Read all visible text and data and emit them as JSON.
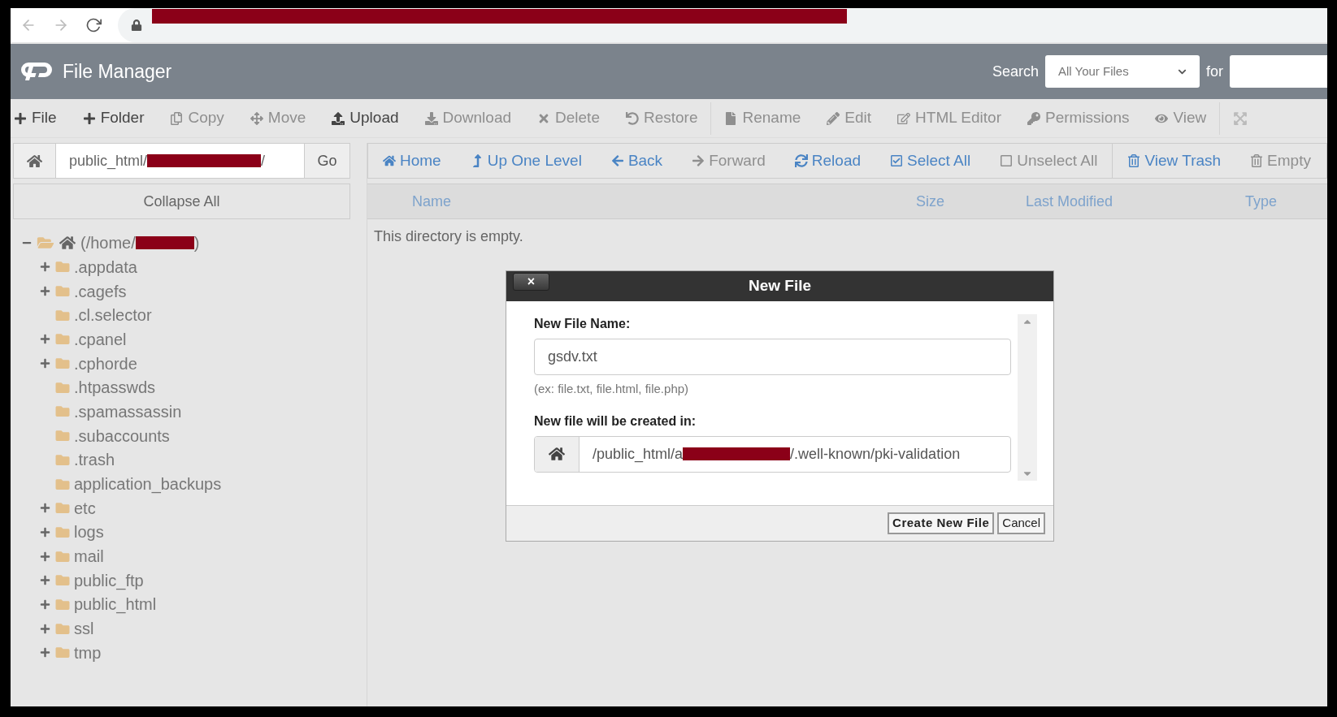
{
  "header": {
    "title": "File Manager",
    "search_label": "Search",
    "search_scope": "All Your Files",
    "for_label": "for"
  },
  "toolbar": [
    {
      "label": "File",
      "disabled": false
    },
    {
      "label": "Folder",
      "disabled": false
    },
    {
      "label": "Copy",
      "disabled": true
    },
    {
      "label": "Move",
      "disabled": true
    },
    {
      "label": "Upload",
      "disabled": false
    },
    {
      "label": "Download",
      "disabled": true
    },
    {
      "label": "Delete",
      "disabled": true
    },
    {
      "label": "Restore",
      "disabled": true
    },
    {
      "label": "Rename",
      "disabled": true
    },
    {
      "label": "Edit",
      "disabled": true
    },
    {
      "label": "HTML Editor",
      "disabled": true
    },
    {
      "label": "Permissions",
      "disabled": true
    },
    {
      "label": "View",
      "disabled": true
    }
  ],
  "path_bar": {
    "prefix": "public_html/",
    "suffix": "/",
    "go": "Go"
  },
  "collapse_all": "Collapse All",
  "tree": {
    "prefix": "(/home/",
    "suffix": ")",
    "expanded": true,
    "children": [
      {
        "label": ".appdata",
        "expandable": true
      },
      {
        "label": ".cagefs",
        "expandable": true
      },
      {
        "label": ".cl.selector",
        "expandable": false
      },
      {
        "label": ".cpanel",
        "expandable": true
      },
      {
        "label": ".cphorde",
        "expandable": true
      },
      {
        "label": ".htpasswds",
        "expandable": false
      },
      {
        "label": ".spamassassin",
        "expandable": false
      },
      {
        "label": ".subaccounts",
        "expandable": false
      },
      {
        "label": ".trash",
        "expandable": false
      },
      {
        "label": "application_backups",
        "expandable": false
      },
      {
        "label": "etc",
        "expandable": true
      },
      {
        "label": "logs",
        "expandable": true
      },
      {
        "label": "mail",
        "expandable": true
      },
      {
        "label": "public_ftp",
        "expandable": true
      },
      {
        "label": "public_html",
        "expandable": true
      },
      {
        "label": "ssl",
        "expandable": true
      },
      {
        "label": "tmp",
        "expandable": true
      }
    ]
  },
  "nav": [
    {
      "label": "Home",
      "disabled": false
    },
    {
      "label": "Up One Level",
      "disabled": false
    },
    {
      "label": "Back",
      "disabled": false
    },
    {
      "label": "Forward",
      "disabled": true
    },
    {
      "label": "Reload",
      "disabled": false
    },
    {
      "label": "Select All",
      "disabled": false
    },
    {
      "label": "Unselect All",
      "disabled": true
    },
    {
      "label": "View Trash",
      "disabled": false
    },
    {
      "label": "Empty",
      "disabled": true
    }
  ],
  "table": {
    "columns": [
      "Name",
      "Size",
      "Last Modified",
      "Type"
    ],
    "empty_message": "This directory is empty."
  },
  "dialog": {
    "title": "New File",
    "close": "×",
    "name_label": "New File Name:",
    "name_value": "gsdv.txt",
    "hint": "(ex: file.txt, file.html, file.php)",
    "location_label": "New file will be created in:",
    "location_prefix": "/public_html/a",
    "location_suffix": "/.well-known/pki-validation",
    "buttons": [
      "Create New File",
      "Cancel"
    ]
  }
}
